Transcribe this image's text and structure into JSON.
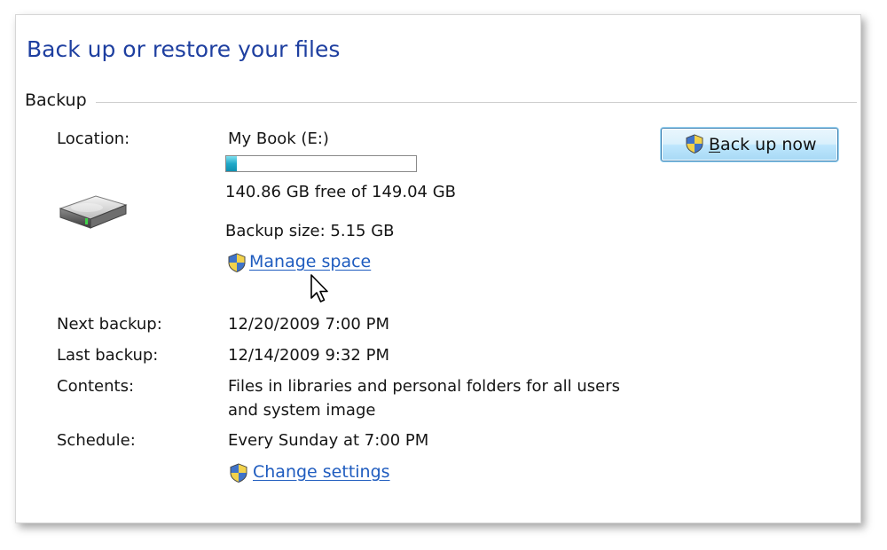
{
  "window": {
    "title": "Back up or restore your files"
  },
  "backup_section": {
    "label": "Backup",
    "location_label": "Location:",
    "location_value": "My Book (E:)",
    "storage_used_fraction": 0.055,
    "free_space_text": "140.86 GB free of 149.04 GB",
    "backup_size_text": "Backup size: 5.15 GB",
    "manage_space_link": "Manage space",
    "next_backup_label": "Next backup:",
    "next_backup_value": "12/20/2009 7:00 PM",
    "last_backup_label": "Last backup:",
    "last_backup_value": "12/14/2009 9:32 PM",
    "contents_label": "Contents:",
    "contents_line1": "Files in libraries and personal folders for all users",
    "contents_line2": "and system image",
    "schedule_label": "Schedule:",
    "schedule_value": "Every Sunday at 7:00 PM",
    "change_settings_link": "Change settings"
  },
  "back_up_now_button": {
    "accelerator": "B",
    "rest": "ack up now"
  },
  "icons": {
    "drive": "external-drive-icon",
    "shield": "uac-shield-icon",
    "cursor": "mouse-pointer-icon"
  },
  "colors": {
    "title": "#1e3fa0",
    "link": "#1f5cbf",
    "progress_fill": "#21a9c9",
    "button_border": "#3c7fb1"
  }
}
